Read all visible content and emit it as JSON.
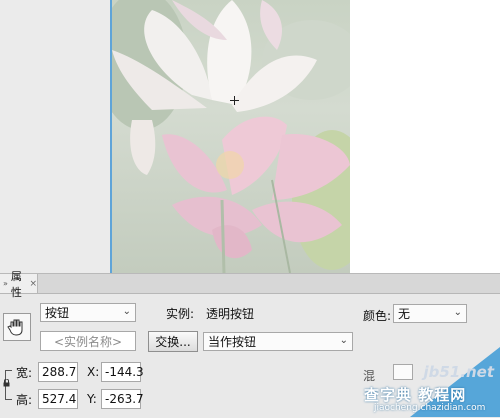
{
  "properties_panel": {
    "tab_label": "属性",
    "tab_close": "×",
    "tab_chevron": "»",
    "symbol_type": {
      "value": "按钮",
      "options_visible": [
        "按钮"
      ]
    },
    "instance_name": {
      "value": "",
      "placeholder": "<实例名称>"
    },
    "instance_label": "实例:",
    "instance_value": "透明按钮",
    "swap_button": "交换...",
    "instance_behavior": {
      "value": "当作按钮"
    },
    "color_label": "颜色:",
    "color_effect": {
      "value": "无"
    },
    "width_label": "宽:",
    "width_value": "288.7",
    "height_label": "高:",
    "height_value": "527.4",
    "x_label": "X:",
    "x_value": "-144.3",
    "y_label": "Y:",
    "y_value": "-263.7",
    "blend_label": "混"
  },
  "watermark": {
    "site": "jb51.net",
    "title": "查字典 教程网",
    "url": "jiaocheng.chazidian.com"
  },
  "icons": {
    "dropdown_arrow": "chevron-down-icon",
    "button_symbol": "hand-cursor-icon",
    "lock": "lock-icon",
    "registration": "crosshair-icon"
  },
  "colors": {
    "selection_border": "#5fa4d8",
    "watermark_blue": "#3c9ad6"
  }
}
